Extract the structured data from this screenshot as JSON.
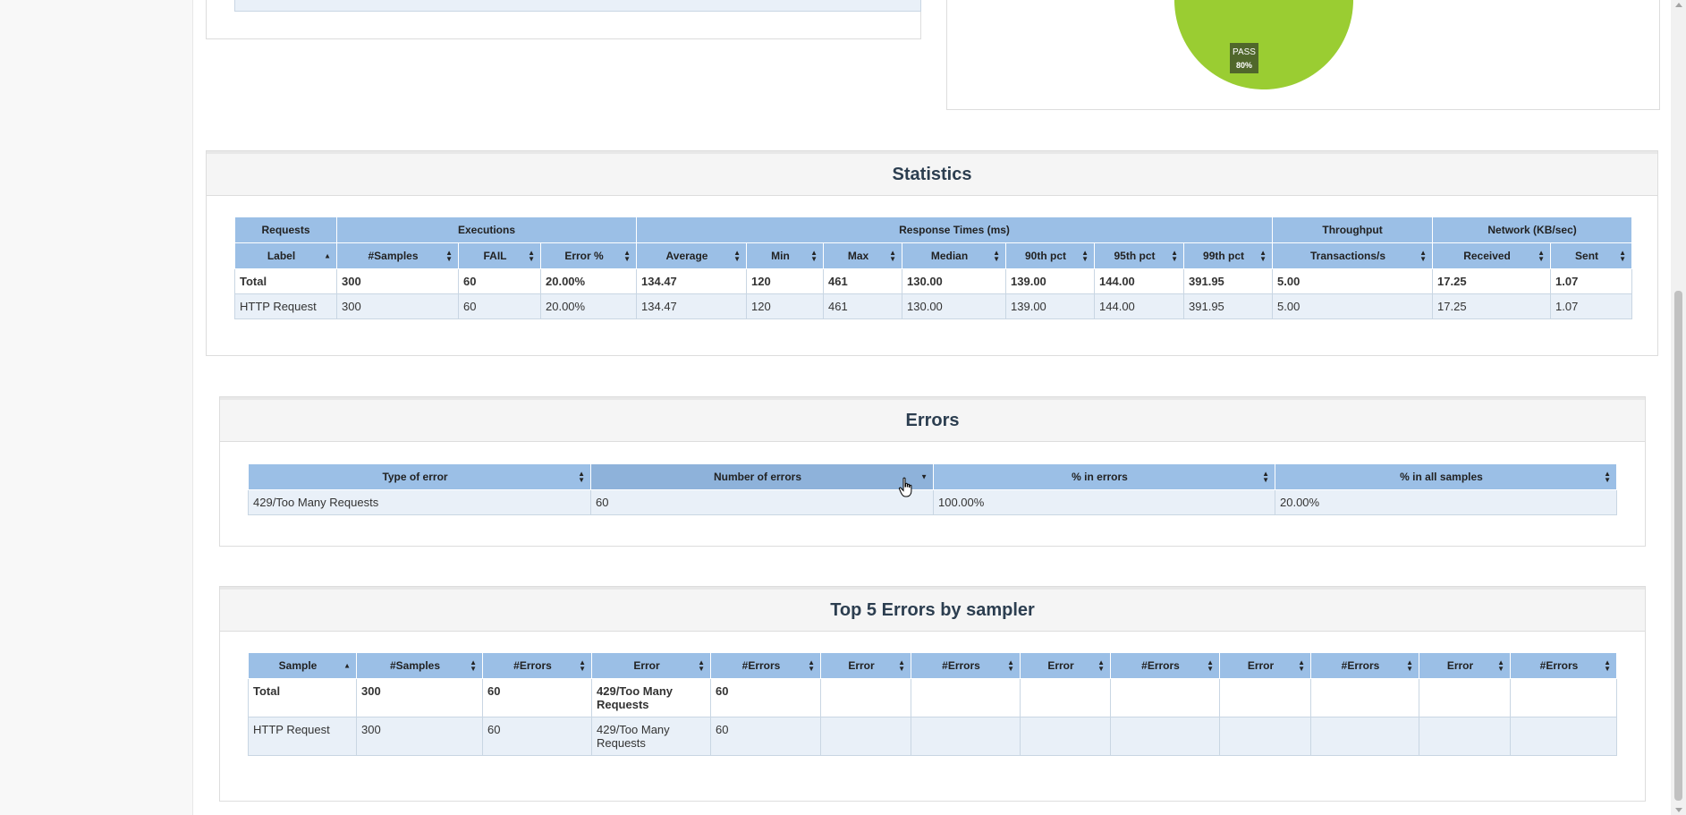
{
  "pie": {
    "pass_label": "PASS",
    "pass_pct": "80%",
    "pass_fraction": 0.8,
    "fail_fraction": 0.2,
    "pass_color": "#9acd32",
    "fail_color": "#ff5a36"
  },
  "statistics": {
    "title": "Statistics",
    "groups": [
      "Requests",
      "Executions",
      "Response Times (ms)",
      "Throughput",
      "Network (KB/sec)"
    ],
    "columns": [
      "Label",
      "#Samples",
      "FAIL",
      "Error %",
      "Average",
      "Min",
      "Max",
      "Median",
      "90th pct",
      "95th pct",
      "99th pct",
      "Transactions/s",
      "Received",
      "Sent"
    ],
    "rows": [
      [
        "Total",
        "300",
        "60",
        "20.00%",
        "134.47",
        "120",
        "461",
        "130.00",
        "139.00",
        "144.00",
        "391.95",
        "5.00",
        "17.25",
        "1.07"
      ],
      [
        "HTTP Request",
        "300",
        "60",
        "20.00%",
        "134.47",
        "120",
        "461",
        "130.00",
        "139.00",
        "144.00",
        "391.95",
        "5.00",
        "17.25",
        "1.07"
      ]
    ]
  },
  "errors": {
    "title": "Errors",
    "columns": [
      "Type of error",
      "Number of errors",
      "% in errors",
      "% in all samples"
    ],
    "rows": [
      [
        "429/Too Many Requests",
        "60",
        "100.00%",
        "20.00%"
      ]
    ]
  },
  "top5": {
    "title": "Top 5 Errors by sampler",
    "columns": [
      "Sample",
      "#Samples",
      "#Errors",
      "Error",
      "#Errors",
      "Error",
      "#Errors",
      "Error",
      "#Errors",
      "Error",
      "#Errors",
      "Error",
      "#Errors"
    ],
    "rows": [
      [
        "Total",
        "300",
        "60",
        "429/Too Many Requests",
        "60",
        "",
        "",
        "",
        "",
        "",
        "",
        "",
        ""
      ],
      [
        "HTTP Request",
        "300",
        "60",
        "429/Too Many Requests",
        "60",
        "",
        "",
        "",
        "",
        "",
        "",
        "",
        ""
      ]
    ]
  },
  "icons": {
    "sort": "sort-both-icon",
    "sort_asc": "sort-asc-icon",
    "sort_desc": "sort-desc-icon",
    "cursor": "hand-pointer-icon"
  }
}
